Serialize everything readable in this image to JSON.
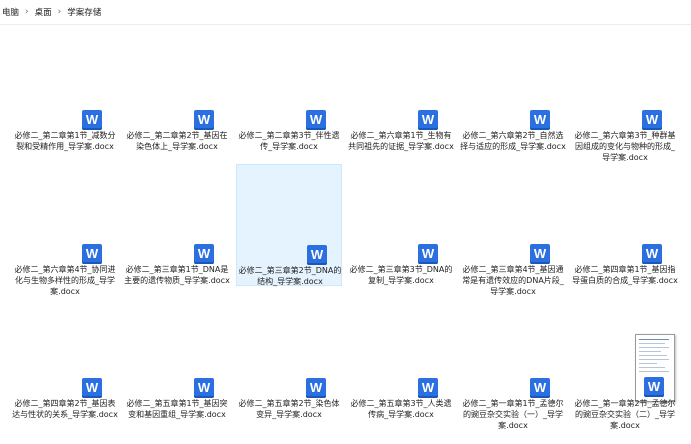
{
  "breadcrumb": [
    "电脑",
    "桌面",
    "学案存储"
  ],
  "files": [
    {
      "name": "必修二_第二章第1节_减数分\n裂和受精作用_导学案.docx",
      "icon": "word-icon"
    },
    {
      "name": "必修二_第二章第2节_基因在\n染色体上_导学案.docx",
      "icon": "word-icon"
    },
    {
      "name": "必修二_第二章第3节_伴性遗\n传_导学案.docx",
      "icon": "word-icon"
    },
    {
      "name": "必修二_第六章第1节_生物有\n共同祖先的证据_导学案.docx",
      "icon": "word-icon"
    },
    {
      "name": "必修二_第六章第2节_自然选\n择与适应的形成_导学案.docx",
      "icon": "word-icon"
    },
    {
      "name": "必修二_第六章第3节_种群基\n因组成的变化与物种的形成_\n导学案.docx",
      "icon": "word-icon"
    },
    {
      "name": "必修二_第六章第4节_协同进\n化与生物多样性的形成_导学\n案.docx",
      "icon": "word-icon"
    },
    {
      "name": "必修二_第三章第1节_DNA是\n主要的遗传物质_导学案.docx",
      "icon": "word-icon"
    },
    {
      "name": "必修二_第三章第2节_DNA的\n结构_导学案.docx",
      "icon": "word-icon",
      "selected": true
    },
    {
      "name": "必修二_第三章第3节_DNA的\n复制_导学案.docx",
      "icon": "word-icon"
    },
    {
      "name": "必修二_第三章第4节_基因通\n常是有遗传效应的DNA片段_\n导学案.docx",
      "icon": "word-icon"
    },
    {
      "name": "必修二_第四章第1节_基因指\n导蛋白质的合成_导学案.docx",
      "icon": "word-icon"
    },
    {
      "name": "必修二_第四章第2节_基因表\n达与性状的关系_导学案.docx",
      "icon": "word-icon"
    },
    {
      "name": "必修二_第五章第1节_基因突\n变和基因重组_导学案.docx",
      "icon": "word-icon"
    },
    {
      "name": "必修二_第五章第2节_染色体\n变异_导学案.docx",
      "icon": "word-icon"
    },
    {
      "name": "必修二_第五章第3节_人类遗\n传病_导学案.docx",
      "icon": "word-icon"
    },
    {
      "name": "必修二_第一章第1节_孟德尔\n的豌豆杂交实验（一）_导学\n案.docx",
      "icon": "word-icon"
    },
    {
      "name": "必修二_第一章第2节_孟德尔\n的豌豆杂交实验（二）_导学\n案.docx",
      "icon": "word-icon",
      "thumbnail": true
    }
  ],
  "icon_letter": "W",
  "colors": {
    "word_blue": "#2b6fe0",
    "selection": "#e5f3ff"
  }
}
